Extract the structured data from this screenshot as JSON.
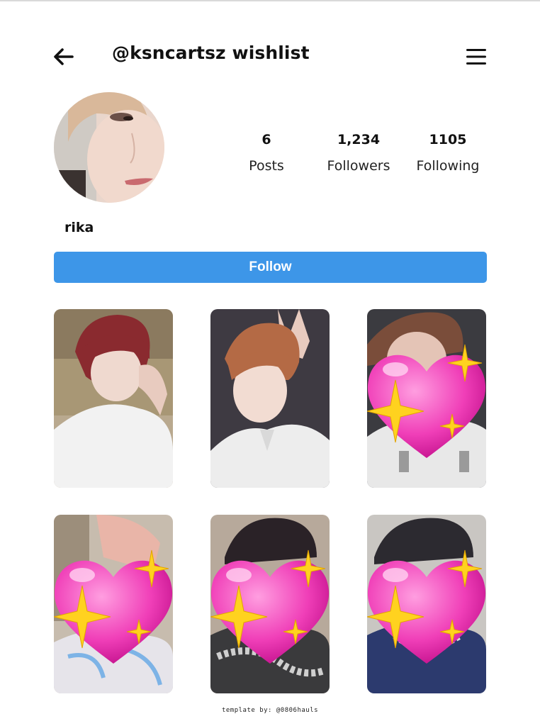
{
  "header": {
    "title": "@ksncartsz wishlist",
    "back_icon": "arrow-left-icon",
    "menu_icon": "hamburger-menu-icon"
  },
  "profile": {
    "name": "rika",
    "stats": [
      {
        "value": "6",
        "label": "Posts"
      },
      {
        "value": "1,234",
        "label": "Followers"
      },
      {
        "value": "1105",
        "label": "Following"
      }
    ]
  },
  "follow_button": {
    "label": "Follow",
    "color": "#3d96e8"
  },
  "grid": {
    "posts": [
      {
        "covered": false
      },
      {
        "covered": false
      },
      {
        "covered": true,
        "overlay": "sparkling-heart-emoji"
      },
      {
        "covered": true,
        "overlay": "sparkling-heart-emoji"
      },
      {
        "covered": true,
        "overlay": "sparkling-heart-emoji"
      },
      {
        "covered": true,
        "overlay": "sparkling-heart-emoji"
      }
    ]
  },
  "footer": {
    "credit": "template by: @0806hauls"
  }
}
